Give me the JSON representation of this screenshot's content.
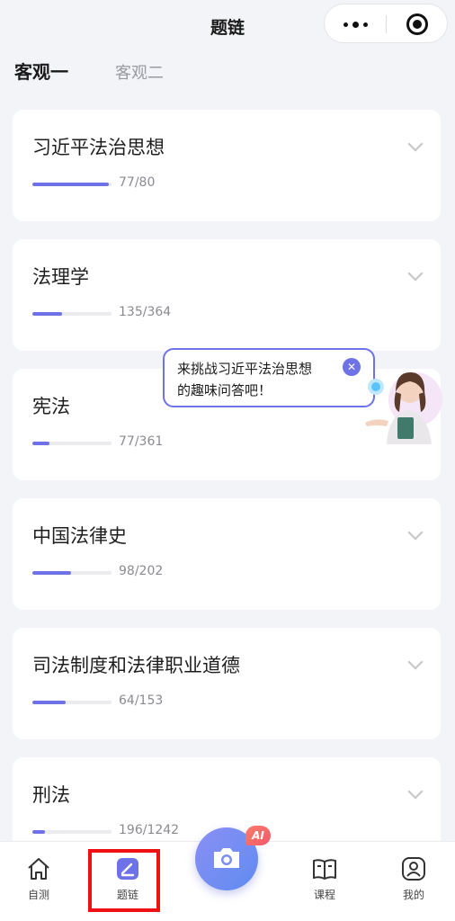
{
  "header": {
    "title": "题链"
  },
  "tabs": [
    {
      "label": "客观一",
      "active": true
    },
    {
      "label": "客观二",
      "active": false
    }
  ],
  "subjects": [
    {
      "name": "习近平法治思想",
      "progress_text": "77/80",
      "done": 77,
      "total": 80
    },
    {
      "name": "法理学",
      "progress_text": "135/364",
      "done": 135,
      "total": 364
    },
    {
      "name": "宪法",
      "progress_text": "77/361",
      "done": 77,
      "total": 361
    },
    {
      "name": "中国法律史",
      "progress_text": "98/202",
      "done": 98,
      "total": 202
    },
    {
      "name": "司法制度和法律职业道德",
      "progress_text": "64/153",
      "done": 64,
      "total": 153
    },
    {
      "name": "刑法",
      "progress_text": "196/1242",
      "done": 196,
      "total": 1242
    }
  ],
  "bubble": {
    "line1": "来挑战习近平法治思想",
    "line2": "的趣味问答吧！"
  },
  "tabbar": {
    "items": [
      {
        "label": "自测",
        "icon": "home-icon"
      },
      {
        "label": "题链",
        "icon": "edit-icon",
        "active": true
      },
      {
        "label": "课程",
        "icon": "book-icon"
      },
      {
        "label": "我的",
        "icon": "profile-icon"
      }
    ],
    "camera": {
      "icon": "camera-icon",
      "badge": "AI"
    }
  },
  "colors": {
    "accent": "#6d72e6",
    "highlight": "#ee1111",
    "background": "#f3f4f8"
  }
}
